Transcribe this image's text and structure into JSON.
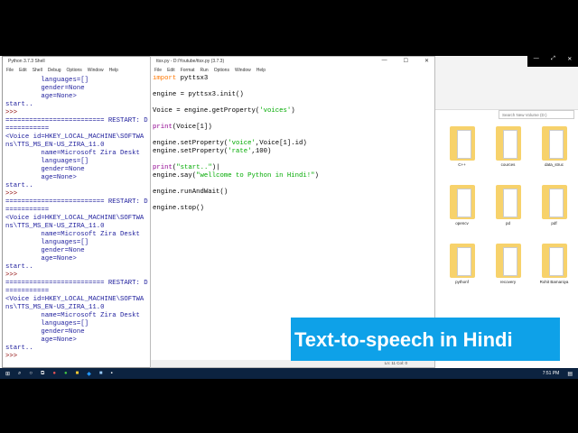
{
  "shell": {
    "title": "Python 3.7.3 Shell",
    "menu": [
      "File",
      "Edit",
      "Shell",
      "Debug",
      "Options",
      "Window",
      "Help"
    ],
    "lines": [
      {
        "t": "         languages=[]",
        "c": "out"
      },
      {
        "t": "         gender=None",
        "c": "out"
      },
      {
        "t": "         age=None>",
        "c": "out"
      },
      {
        "t": "start..",
        "c": "out"
      },
      {
        "t": ">>> ",
        "c": "prompt"
      },
      {
        "t": "========================= RESTART: D",
        "c": "out"
      },
      {
        "t": "===========",
        "c": "out"
      },
      {
        "t": "<Voice id=HKEY_LOCAL_MACHINE\\SOFTWA",
        "c": "out"
      },
      {
        "t": "ns\\TTS_MS_EN-US_ZIRA_11.0",
        "c": "out"
      },
      {
        "t": "         name=Microsoft Zira Deskt",
        "c": "out"
      },
      {
        "t": "         languages=[]",
        "c": "out"
      },
      {
        "t": "         gender=None",
        "c": "out"
      },
      {
        "t": "         age=None>",
        "c": "out"
      },
      {
        "t": "start..",
        "c": "out"
      },
      {
        "t": ">>> ",
        "c": "prompt"
      },
      {
        "t": "========================= RESTART: D",
        "c": "out"
      },
      {
        "t": "===========",
        "c": "out"
      },
      {
        "t": "<Voice id=HKEY_LOCAL_MACHINE\\SOFTWA",
        "c": "out"
      },
      {
        "t": "ns\\TTS_MS_EN-US_ZIRA_11.0",
        "c": "out"
      },
      {
        "t": "         name=Microsoft Zira Deskt",
        "c": "out"
      },
      {
        "t": "         languages=[]",
        "c": "out"
      },
      {
        "t": "         gender=None",
        "c": "out"
      },
      {
        "t": "         age=None>",
        "c": "out"
      },
      {
        "t": "start..",
        "c": "out"
      },
      {
        "t": ">>> ",
        "c": "prompt"
      },
      {
        "t": "========================= RESTART: D",
        "c": "out"
      },
      {
        "t": "===========",
        "c": "out"
      },
      {
        "t": "<Voice id=HKEY_LOCAL_MACHINE\\SOFTWA",
        "c": "out"
      },
      {
        "t": "ns\\TTS_MS_EN-US_ZIRA_11.0",
        "c": "out"
      },
      {
        "t": "         name=Microsoft Zira Deskt",
        "c": "out"
      },
      {
        "t": "         languages=[]",
        "c": "out"
      },
      {
        "t": "         gender=None",
        "c": "out"
      },
      {
        "t": "         age=None>",
        "c": "out"
      },
      {
        "t": "start..",
        "c": "out"
      },
      {
        "t": ">>> ",
        "c": "prompt"
      }
    ]
  },
  "editor": {
    "title": "ttsx.py - D:/Youtube/ttsx.py (3.7.3)",
    "menu": [
      "File",
      "Edit",
      "Format",
      "Run",
      "Options",
      "Window",
      "Help"
    ],
    "code": [
      [
        [
          "import",
          "kw"
        ],
        [
          " pyttsx3",
          ""
        ]
      ],
      [],
      [
        [
          "engine = pyttsx3.init()",
          ""
        ]
      ],
      [],
      [
        [
          "Voice = engine.getProperty(",
          ""
        ],
        [
          "'voices'",
          "str"
        ],
        [
          ")",
          ""
        ]
      ],
      [],
      [
        [
          "print",
          "bi"
        ],
        [
          "(Voice[1])",
          ""
        ]
      ],
      [],
      [
        [
          "engine.setProperty(",
          ""
        ],
        [
          "'voice'",
          "str"
        ],
        [
          ",Voice[1].id)",
          ""
        ]
      ],
      [
        [
          "engine.setProperty(",
          ""
        ],
        [
          "'rate'",
          "str"
        ],
        [
          ",100)",
          ""
        ]
      ],
      [],
      [
        [
          "print",
          "bi"
        ],
        [
          "(",
          ""
        ],
        [
          "\"start..\"",
          "str"
        ],
        [
          ")|",
          ""
        ]
      ],
      [
        [
          "engine.say(",
          ""
        ],
        [
          "\"wellcome to Python in Hindi!\"",
          "str"
        ],
        [
          ")",
          ""
        ]
      ],
      [],
      [
        [
          "engine.runAndWait()",
          ""
        ]
      ],
      [],
      [
        [
          "engine.stop()",
          ""
        ]
      ]
    ],
    "status": "Ln: 11  Col: 0"
  },
  "explorer": {
    "search_placeholder": "Search New Volume (D:)",
    "folders": [
      "C++",
      "cources",
      "data_struc",
      "opencv",
      "pd",
      "pdf",
      "pythonf",
      "recovery",
      "Rohit Bamaniya"
    ]
  },
  "banner": "Text-to-speech in Hindi",
  "taskbar": {
    "time": "7:51 PM"
  }
}
